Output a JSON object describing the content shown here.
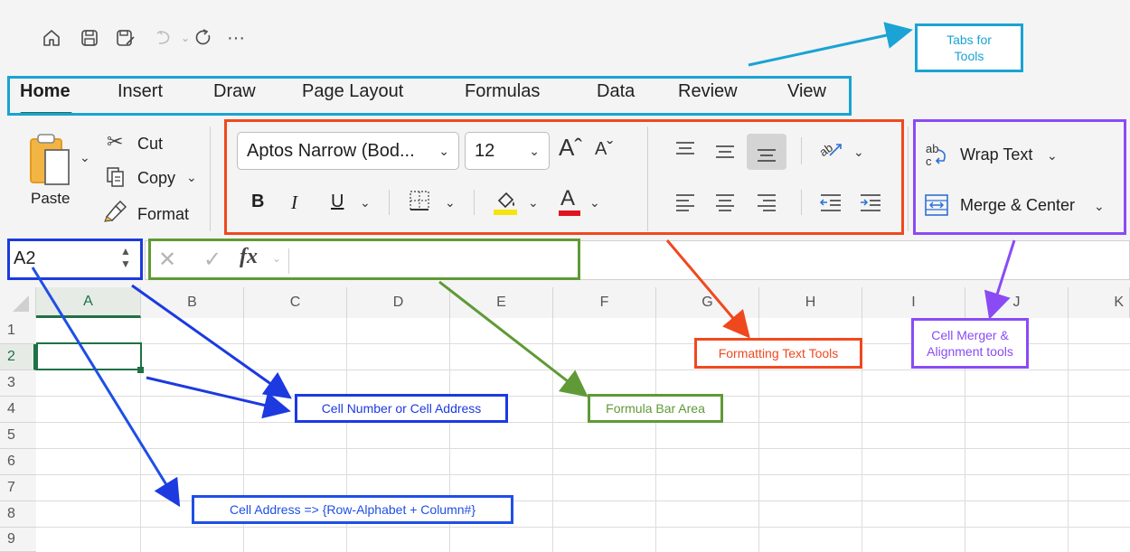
{
  "quick_access": {
    "icons": [
      "home-icon",
      "save-icon",
      "save-as-icon",
      "undo-icon",
      "redo-icon",
      "more-icon"
    ],
    "more_label": "···"
  },
  "tabs": [
    {
      "label": "Home",
      "active": true
    },
    {
      "label": "Insert"
    },
    {
      "label": "Draw"
    },
    {
      "label": "Page Layout"
    },
    {
      "label": "Formulas"
    },
    {
      "label": "Data"
    },
    {
      "label": "Review"
    },
    {
      "label": "View"
    }
  ],
  "clipboard": {
    "paste_label": "Paste",
    "cut_label": "Cut",
    "copy_label": "Copy",
    "format_label": "Format"
  },
  "font": {
    "family_value": "Aptos Narrow (Bod...",
    "size_value": "12",
    "bold": "B",
    "italic": "I",
    "underline": "U",
    "font_color_letter": "A",
    "highlight_color": "#f5e50a",
    "font_color": "#e0141e"
  },
  "alignment": {
    "wrap_text_label": "Wrap Text",
    "merge_center_label": "Merge & Center"
  },
  "name_box": {
    "value": "A2"
  },
  "formula_bar": {
    "fx_label": "fx",
    "value": ""
  },
  "sheet": {
    "columns": [
      "A",
      "B",
      "C",
      "D",
      "E",
      "F",
      "G",
      "H",
      "I",
      "J",
      "K"
    ],
    "rows": [
      "1",
      "2",
      "3",
      "4",
      "5",
      "6",
      "7",
      "8",
      "9"
    ],
    "selected_column": "A",
    "selected_row": "2",
    "accent": "#1e7145"
  },
  "annotations": {
    "tabs_for_tools": [
      "Tabs for",
      "Tools"
    ],
    "formatting_text_tools": "Formatting Text Tools",
    "cell_merger": [
      "Cell Merger &",
      "Alignment tools"
    ],
    "cell_number": "Cell Number or Cell Address",
    "formula_bar_area": "Formula Bar Area",
    "cell_address_rule": "Cell Address => {Row-Alphabet + Column#}",
    "colors": {
      "tabs": "#1aa3d4",
      "formatting": "#f0481e",
      "merger": "#8a4bf5",
      "cell_number": "#1c3ae0",
      "formula": "#5f9a36",
      "address": "#1e4fe6"
    }
  }
}
